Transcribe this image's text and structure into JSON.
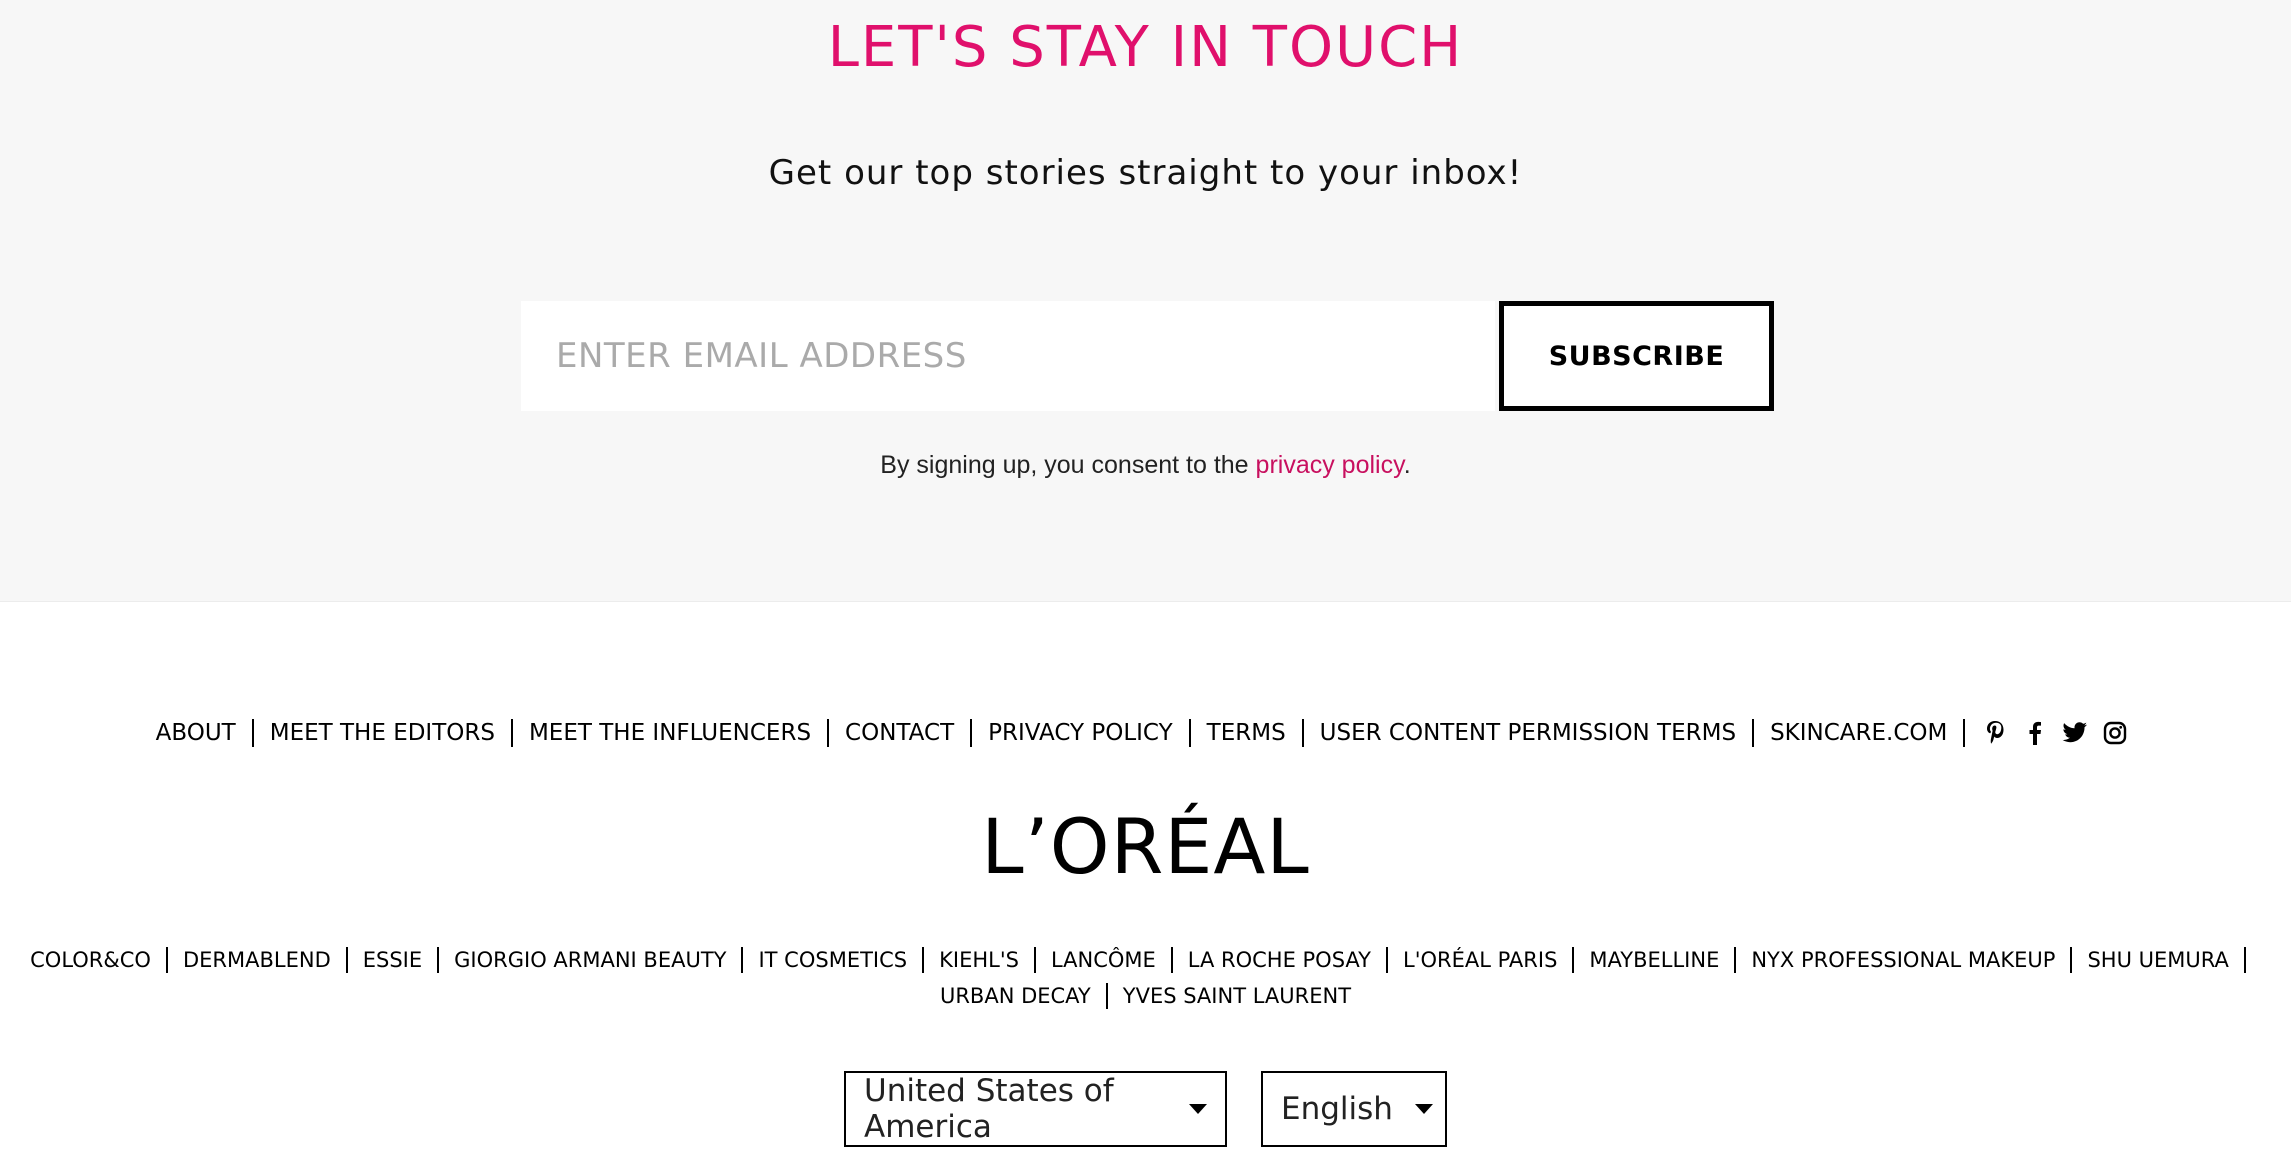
{
  "newsletter": {
    "title": "LET'S STAY IN TOUCH",
    "subtitle": "Get our top stories straight to your inbox!",
    "email_placeholder": "ENTER EMAIL ADDRESS",
    "email_value": "",
    "subscribe_label": "SUBSCRIBE",
    "consent_prefix": "By signing up, you consent to the",
    "consent_link": "privacy policy",
    "consent_suffix": ".",
    "accent_color": "#e0106c"
  },
  "footer_nav": {
    "links": [
      "ABOUT",
      "MEET THE EDITORS",
      "MEET THE INFLUENCERS",
      "CONTACT",
      "PRIVACY POLICY",
      "TERMS",
      "USER CONTENT PERMISSION TERMS",
      "SKINCARE.COM"
    ],
    "social_icons": [
      "pinterest-icon",
      "facebook-icon",
      "twitter-icon",
      "instagram-icon"
    ]
  },
  "logo": {
    "text": "L’ORÉAL"
  },
  "brands": {
    "row1": [
      "COLOR&CO",
      "DERMABLEND",
      "ESSIE",
      "GIORGIO ARMANI BEAUTY",
      "IT COSMETICS",
      "KIEHL'S",
      "LANCÔME",
      "LA ROCHE POSAY",
      "L'ORÉAL PARIS",
      "MAYBELLINE",
      "NYX PROFESSIONAL MAKEUP",
      "SHU UEMURA"
    ],
    "row2": [
      "URBAN DECAY",
      "YVES SAINT LAURENT"
    ]
  },
  "selectors": {
    "country": "United States of America",
    "language": "English"
  }
}
